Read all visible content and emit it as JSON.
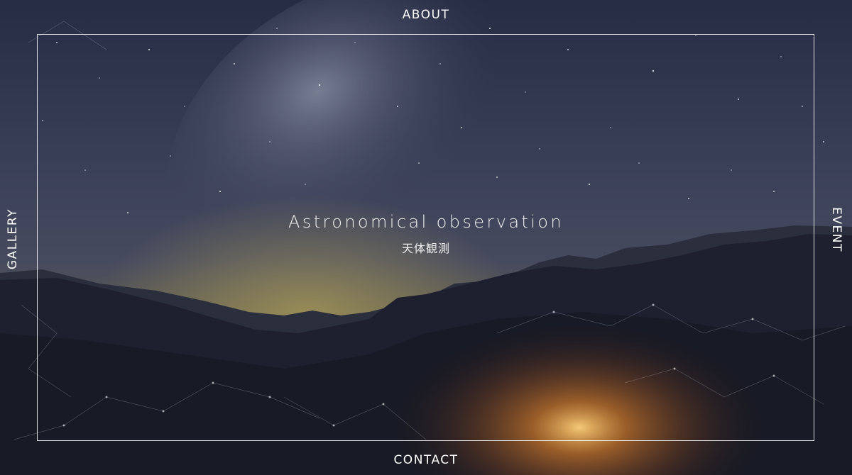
{
  "nav": {
    "top": "ABOUT",
    "left": "GALLERY",
    "right": "EVENT",
    "bottom": "CONTACT"
  },
  "hero": {
    "title": "Astronomical observation",
    "subtitle": "天体観測"
  },
  "background": {
    "description_icon": "night-sky-milky-way-mountains-campfire",
    "sky_top": "#2a3149",
    "sky_mid": "#4a5068",
    "glow": "#b9a45a",
    "ground": "#1c1d28",
    "fire": "#e88a2c",
    "frame_color": "#ffffff"
  }
}
